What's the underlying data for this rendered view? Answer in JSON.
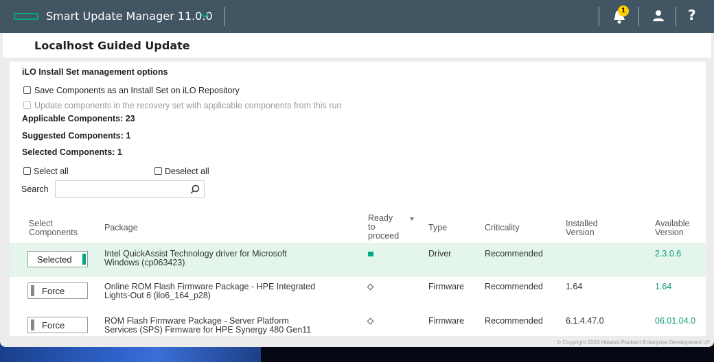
{
  "header": {
    "app_title": "Smart Update Manager 11.0.0",
    "notification_count": "1",
    "help_label": "?"
  },
  "page": {
    "title": "Localhost Guided Update"
  },
  "install_set": {
    "heading": "iLO Install Set management options",
    "save_option": "Save Components as an Install Set on iLO Repository",
    "update_option": "Update components in the recovery set with applicable components from this run"
  },
  "summary": {
    "applicable": "Applicable Components: 23",
    "suggested": "Suggested Components: 1",
    "selected": "Selected Components: 1"
  },
  "selection": {
    "select_all": "Select all",
    "deselect_all": "Deselect all"
  },
  "search": {
    "label": "Search",
    "value": ""
  },
  "table": {
    "headers": {
      "select_line1": "Select",
      "select_line2": "Components",
      "package": "Package",
      "ready_line1": "Ready",
      "ready_line2": "to",
      "ready_line3": "proceed",
      "type": "Type",
      "criticality": "Criticality",
      "installed_line1": "Installed",
      "installed_line2": "Version",
      "available_line1": "Available",
      "available_line2": "Version"
    },
    "rows": [
      {
        "button": "Selected",
        "package_line1": "Intel QuickAssist Technology driver for Microsoft",
        "package_line2": "Windows (cp063423)",
        "ready": "ready",
        "type": "Driver",
        "criticality": "Recommended",
        "installed": "",
        "available": "2.3.0.6"
      },
      {
        "button": "Force",
        "package_line1": "Online ROM Flash Firmware Package - HPE Integrated",
        "package_line2": "Lights-Out 6 (ilo6_164_p28)",
        "ready": "not-ready",
        "type": "Firmware",
        "criticality": "Recommended",
        "installed": "1.64",
        "available": "1.64"
      },
      {
        "button": "Force",
        "package_line1": "ROM Flash Firmware Package - Server Platform",
        "package_line2": "Services (SPS) Firmware for HPE Synergy 480 Gen11",
        "ready": "not-ready",
        "type": "Firmware",
        "criticality": "Recommended",
        "installed": "6.1.4.47.0",
        "available": "06.01.04.0"
      }
    ]
  },
  "footer": {
    "copyright": "© Copyright 2024 Hewlett Packard Enterprise Development LP"
  },
  "colors": {
    "accent": "#01a982",
    "topbar": "#425563",
    "badge": "#ffd100",
    "selected_row": "#e4f6ec"
  }
}
